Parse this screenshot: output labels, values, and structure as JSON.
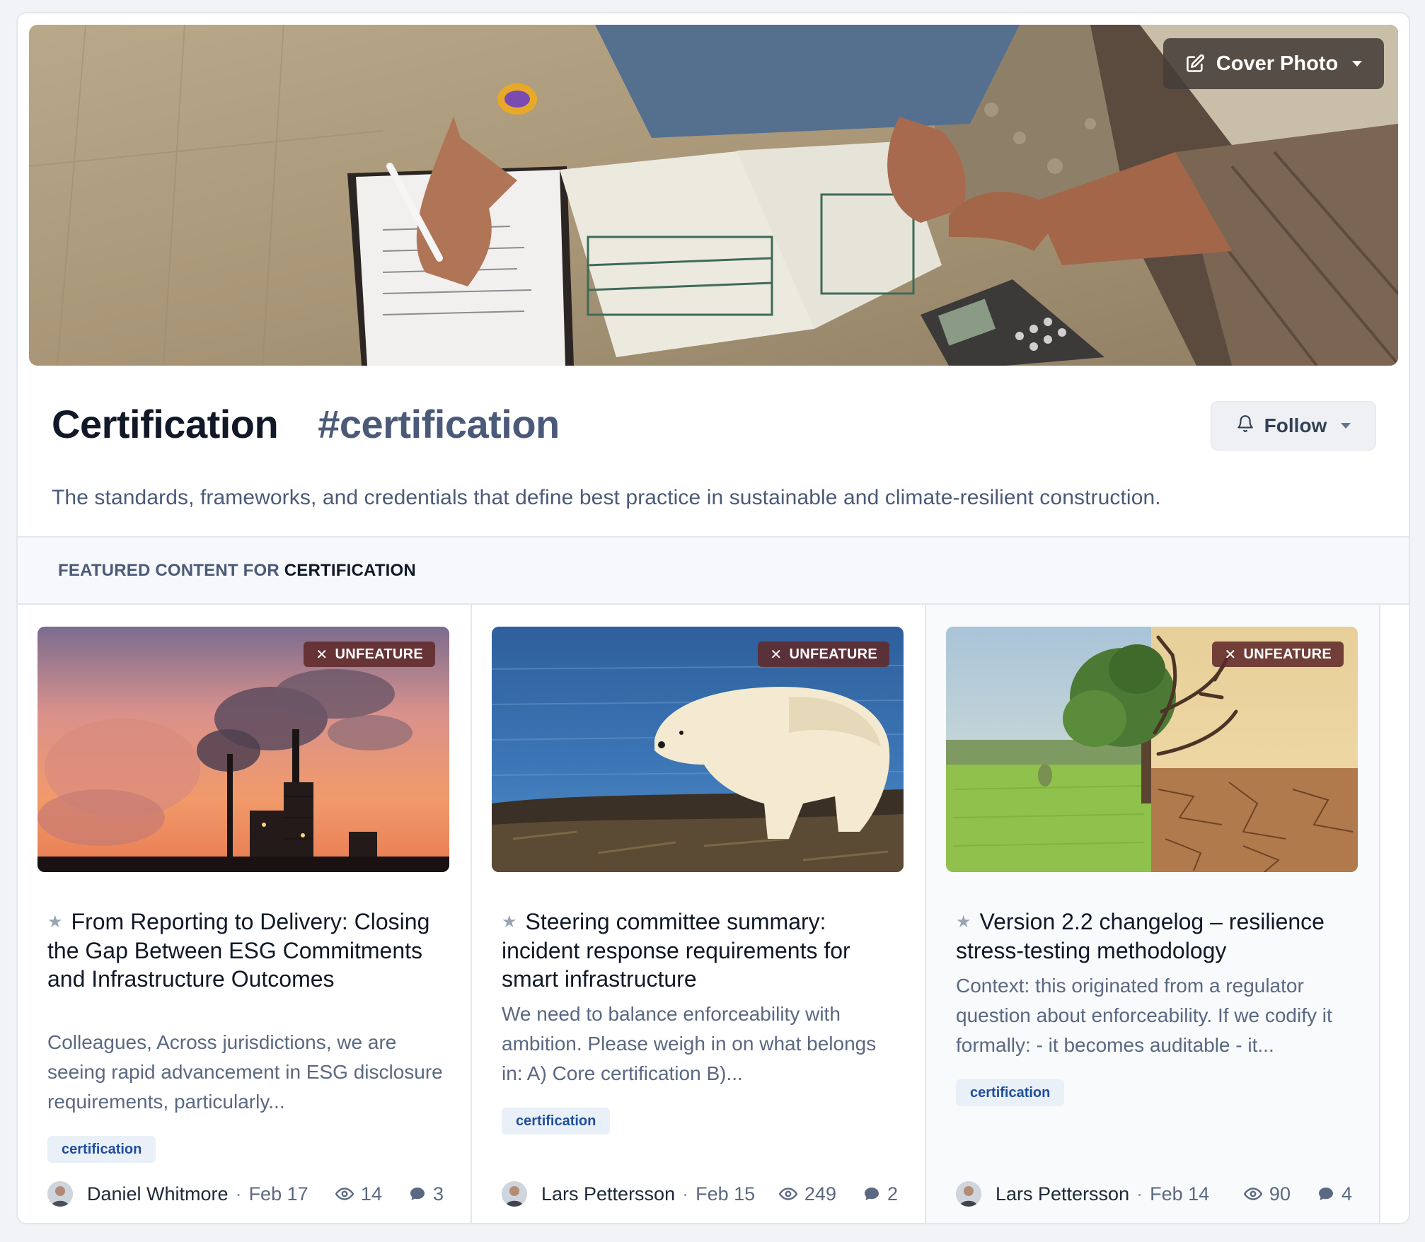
{
  "cover": {
    "button_label": "Cover Photo",
    "icon": "edit-icon"
  },
  "topic": {
    "title": "Certification",
    "hashtag": "#certification",
    "follow_label": "Follow",
    "description": "The standards, frameworks, and credentials that define best practice in sustainable and climate-resilient construction."
  },
  "featured": {
    "label_prefix": "FEATURED CONTENT FOR ",
    "label_topic": "CERTIFICATION"
  },
  "cards": [
    {
      "unfeature_label": "UNFEATURE",
      "title": "From Reporting to Delivery: Closing the Gap Between ESG Commitments and Infrastructure Outcomes",
      "excerpt": "Colleagues, Across jurisdictions, we are seeing rapid advancement in ESG disclosure requirements, particularly...",
      "tag": "certification",
      "author": "Daniel Whitmore",
      "date": "Feb 17",
      "views": "14",
      "comments": "3"
    },
    {
      "unfeature_label": "UNFEATURE",
      "title": "Steering committee summary: incident response requirements for smart infrastructure",
      "excerpt": "We need to balance enforceability with ambition. Please weigh in on what belongs in: A) Core certification B)...",
      "tag": "certification",
      "author": "Lars Pettersson",
      "date": "Feb 15",
      "views": "249",
      "comments": "2"
    },
    {
      "unfeature_label": "UNFEATURE",
      "title": "Version 2.2 changelog – resilience stress-testing methodology",
      "excerpt": "Context: this originated from a regulator question about enforceability. If we codify it formally: - it becomes auditable - it...",
      "tag": "certification",
      "author": "Lars Pettersson",
      "date": "Feb 14",
      "views": "90",
      "comments": "4"
    }
  ]
}
